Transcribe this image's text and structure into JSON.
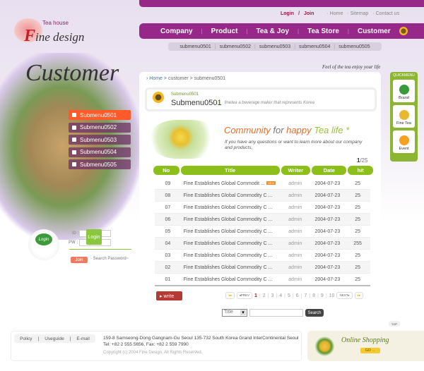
{
  "header": {
    "logo_small": "Tea house",
    "logo_main": "ine design",
    "logo_initial": "F",
    "util": {
      "login": "Login",
      "sep": "/",
      "join": "Join",
      "links": [
        "· Home",
        "· Sitemap",
        "· Contact us"
      ]
    },
    "nav": [
      "Company",
      "Product",
      "Tea & Joy",
      "Tea Store",
      "Customer"
    ],
    "subnav": [
      "submenu0501",
      "submenu0502",
      "submenu0503",
      "submenu0504",
      "submenu0505"
    ],
    "tagline": "Feel of the tea enjoy your life"
  },
  "left": {
    "hero_title": "Customer",
    "menu": [
      "Submenu0501",
      "Submenu0502",
      "Submenu0503",
      "Submenu0504",
      "Submenu0505"
    ],
    "login": {
      "cup_label": "Login",
      "id_label": "ID :",
      "pw_label": "PW :",
      "button": "Login",
      "join": "Join",
      "search_password": "· Search Password~"
    }
  },
  "main": {
    "breadcrumb": {
      "home": "Home",
      "path": " > customer > submenu0501"
    },
    "subhead": {
      "small": "Submenu0501",
      "title": "Submenu0501",
      "desc": "finetea  a beverage maker that represents Korea"
    },
    "banner": {
      "w1": "Community",
      "w2": " for ",
      "w3": "happy",
      "w4": " Tea life",
      "w5": " *",
      "text": "If you have any questions or want to learn more about our company and products,"
    },
    "page_current": "1",
    "page_total": "/25",
    "columns": [
      "No",
      "Title",
      "Writer",
      "Date",
      "hit"
    ],
    "rows": [
      {
        "no": "09",
        "title": "Fine Establishes Global Commodit ...",
        "new": "NEW",
        "writer": "admin",
        "date": "2004-07-23",
        "hit": "25"
      },
      {
        "no": "08",
        "title": "Fine Establishes Global Commodity C ...",
        "writer": "admin",
        "date": "2004-07-23",
        "hit": "25"
      },
      {
        "no": "07",
        "title": "Fine Establishes Global Commodity C ...",
        "writer": "admin",
        "date": "2004-07-23",
        "hit": "25"
      },
      {
        "no": "06",
        "title": "Fine Establishes Global Commodity C ...",
        "writer": "admin",
        "date": "2004-07-23",
        "hit": "25"
      },
      {
        "no": "05",
        "title": "Fine Establishes Global Commodity C ...",
        "writer": "admin",
        "date": "2004-07-23",
        "hit": "25"
      },
      {
        "no": "04",
        "title": "Fine Establishes Global Commodity C ...",
        "writer": "admin",
        "date": "2004-07-23",
        "hit": "255"
      },
      {
        "no": "03",
        "title": "Fine Establishes Global Commodity C ...",
        "writer": "admin",
        "date": "2004-07-23",
        "hit": "25"
      },
      {
        "no": "02",
        "title": "Fine Establishes Global Commodity C ...",
        "writer": "admin",
        "date": "2004-07-23",
        "hit": "25"
      },
      {
        "no": "01",
        "title": "Fine Establishes Global Commodity C ...",
        "writer": "admin",
        "date": "2004-07-23",
        "hit": "25"
      }
    ],
    "write": "▸ write",
    "pager": {
      "first": "◂◂",
      "prev": "◂PREV",
      "pages": [
        "1",
        "2",
        "3",
        "4",
        "5",
        "6",
        "7",
        "8",
        "9",
        "10"
      ],
      "next": "NEXT▸",
      "last": "▸▸"
    },
    "search": {
      "field": "Title",
      "button": "Search"
    }
  },
  "quickmenu": {
    "title": "QUICKMENU",
    "items": [
      "Brand",
      "Fine Tea",
      "Event"
    ]
  },
  "top": "TOP",
  "footer": {
    "links": [
      "Policy",
      "Useguide",
      "E-mail"
    ],
    "address": "159-8 Samseong-Dong Gangnam-Gu Seoul 135-732 South Korea Grand InterContinental Seoul",
    "tel": "Tel: +82 2 555 5656, Fax: +82 2 559 7990",
    "copyright": "Copyright (c) 2004 Fine Design. All Rights Reserved.",
    "shop": {
      "title": "Online Shopping",
      "go": "GO →"
    }
  },
  "colors": {
    "purple": "#97288a",
    "green": "#8cbf1a",
    "orange": "#ff5a2a",
    "red": "#b53a35"
  }
}
